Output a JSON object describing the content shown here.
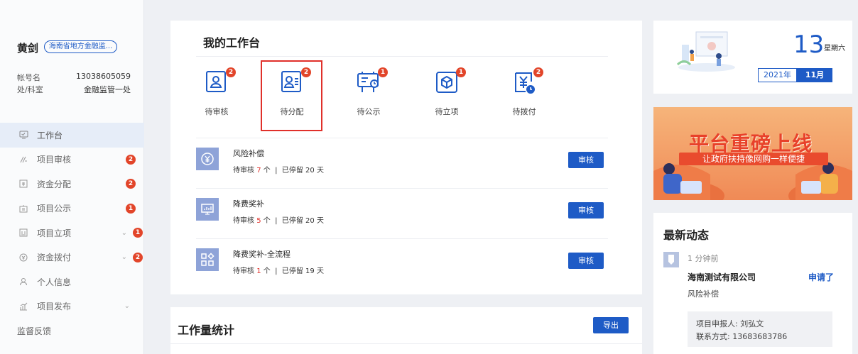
{
  "user": {
    "name": "黄剑",
    "org": "海南省地方金融监...",
    "account_label": "帐号名",
    "account_value": "13038605059",
    "dept_label": "处/科室",
    "dept_value": "金融监管一处"
  },
  "menu": [
    {
      "label": "工作台",
      "icon": "desktop-icon"
    },
    {
      "label": "项目审核",
      "icon": "audit-icon",
      "badge": "2"
    },
    {
      "label": "资金分配",
      "icon": "allocate-icon",
      "badge": "2"
    },
    {
      "label": "项目公示",
      "icon": "publicity-icon",
      "badge": "1"
    },
    {
      "label": "项目立项",
      "icon": "project-icon",
      "badge": "1"
    },
    {
      "label": "资金拨付",
      "icon": "payment-icon",
      "badge": "2"
    },
    {
      "label": "个人信息",
      "icon": "user-icon"
    },
    {
      "label": "项目发布",
      "icon": "publish-icon"
    },
    {
      "label": "监督反馈"
    }
  ],
  "workspace": {
    "title": "我的工作台",
    "tasks": [
      {
        "label": "待审核",
        "count": "2"
      },
      {
        "label": "待分配",
        "count": "2"
      },
      {
        "label": "待公示",
        "count": "1"
      },
      {
        "label": "待立项",
        "count": "1"
      },
      {
        "label": "待拨付",
        "count": "2"
      }
    ],
    "items": [
      {
        "name": "风险补偿",
        "pending_label": "待审核",
        "count": "7",
        "unit": "个",
        "stay_label": "已停留",
        "days": "20",
        "days_unit": "天",
        "button": "审核"
      },
      {
        "name": "降费奖补",
        "pending_label": "待审核",
        "count": "5",
        "unit": "个",
        "stay_label": "已停留",
        "days": "20",
        "days_unit": "天",
        "button": "审核"
      },
      {
        "name": "降费奖补-全流程",
        "pending_label": "待审核",
        "count": "1",
        "unit": "个",
        "stay_label": "已停留",
        "days": "19",
        "days_unit": "天",
        "button": "审核"
      }
    ],
    "separator": "|"
  },
  "workload": {
    "title": "工作量统计",
    "export_label": "导出"
  },
  "calendar": {
    "day": "13",
    "weekday": "星期六",
    "year": "2021年",
    "month": "11月"
  },
  "banner": {
    "title": "平台重磅上线",
    "subtitle": "让政府扶持像网购一样便捷"
  },
  "news": {
    "title": "最新动态",
    "time": "1 分钟前",
    "company": "海南测试有限公司",
    "action": "申请了",
    "type": "风险补偿",
    "applicant": "项目申报人: 刘弘文",
    "contact": "联系方式: 13683683786"
  },
  "colors": {
    "primary": "#1e5bc6",
    "badge": "#e2452a",
    "highlight": "#e0302a",
    "icon_tile": "#8ea3d8"
  }
}
